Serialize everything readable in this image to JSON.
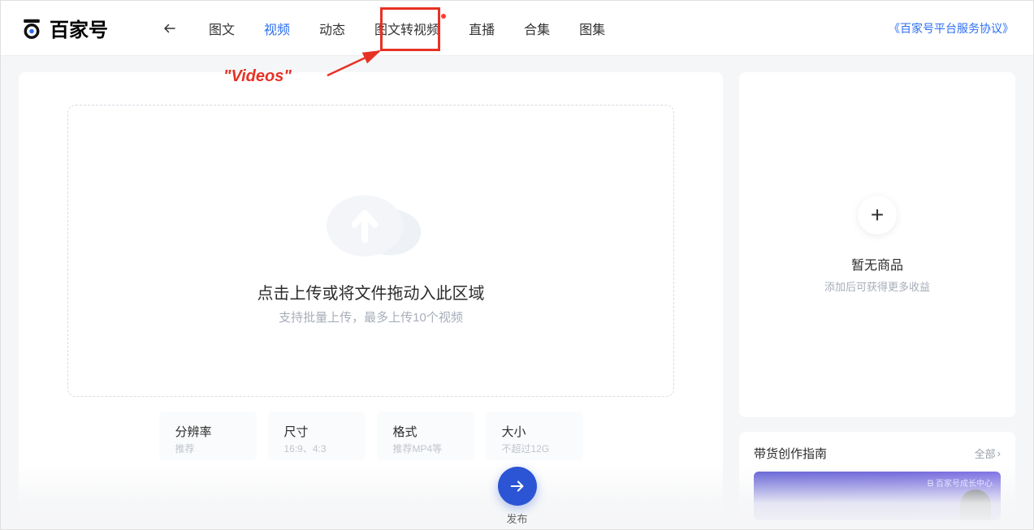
{
  "logo": {
    "text": "百家号"
  },
  "tabs": [
    {
      "label": "图文",
      "active": false
    },
    {
      "label": "视频",
      "active": true
    },
    {
      "label": "动态",
      "active": false
    },
    {
      "label": "图文转视频",
      "active": false,
      "dot": true
    },
    {
      "label": "直播",
      "active": false
    },
    {
      "label": "合集",
      "active": false
    },
    {
      "label": "图集",
      "active": false
    }
  ],
  "header_link": "《百家号平台服务协议》",
  "upload": {
    "title": "点击上传或将文件拖动入此区域",
    "subtitle": "支持批量上传，最多上传10个视频"
  },
  "specs": [
    {
      "label": "分辨率",
      "value": "推荐"
    },
    {
      "label": "尺寸",
      "value": "16:9、4:3"
    },
    {
      "label": "格式",
      "value": "推荐MP4等"
    },
    {
      "label": "大小",
      "value": "不超过12G"
    }
  ],
  "goods": {
    "title": "暂无商品",
    "subtitle": "添加后可获得更多收益"
  },
  "guide": {
    "title": "带货创作指南",
    "all": "全部",
    "banner_brand": "百家号成长中心"
  },
  "publish": {
    "label": "发布"
  },
  "annotation": {
    "text": "\"Videos\""
  }
}
